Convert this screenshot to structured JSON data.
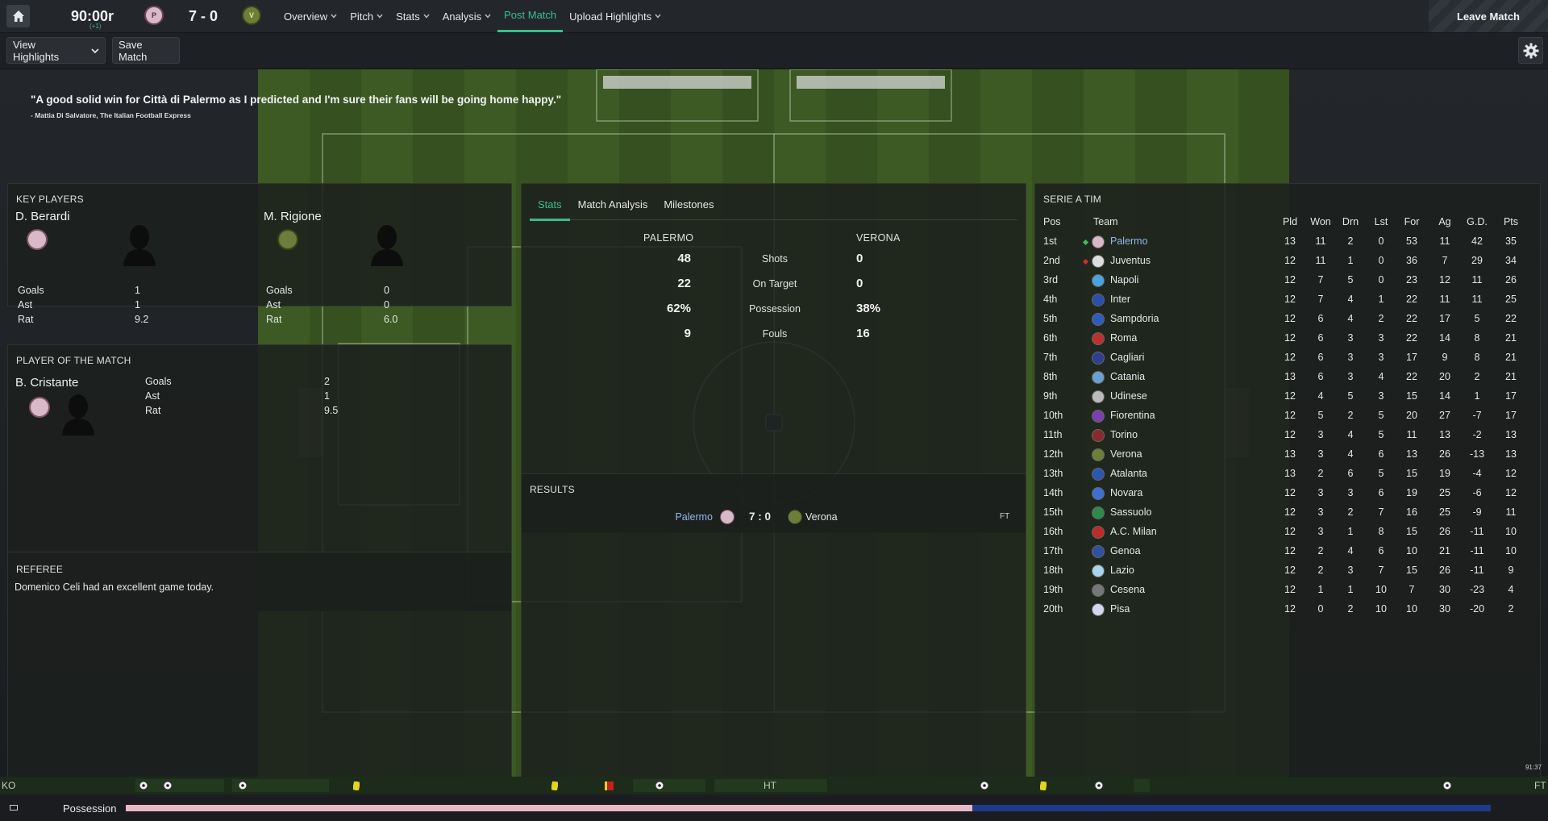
{
  "topbar": {
    "clock": "90:00r",
    "clock_sub": "(+1)",
    "score": "7 - 0",
    "nav": [
      {
        "label": "Overview",
        "dropdown": true,
        "active": false
      },
      {
        "label": "Pitch",
        "dropdown": true,
        "active": false
      },
      {
        "label": "Stats",
        "dropdown": true,
        "active": false
      },
      {
        "label": "Analysis",
        "dropdown": true,
        "active": false
      },
      {
        "label": "Post Match",
        "dropdown": false,
        "active": true
      },
      {
        "label": "Upload Highlights",
        "dropdown": true,
        "active": false
      }
    ],
    "leave_label": "Leave Match"
  },
  "subbar": {
    "view_highlights": "View Highlights",
    "save_match": "Save Match"
  },
  "quote": {
    "text": "\"A good solid win for Città di Palermo as I predicted and I'm sure their fans will be going home happy.\"",
    "source": "- Mattia Di Salvatore, The Italian Football Express"
  },
  "key_players": {
    "title": "KEY PLAYERS",
    "players": [
      {
        "name": "D. Berardi",
        "stats": [
          {
            "label": "Goals",
            "value": "1"
          },
          {
            "label": "Ast",
            "value": "1"
          },
          {
            "label": "Rat",
            "value": "9.2"
          }
        ]
      },
      {
        "name": "M. Rigione",
        "stats": [
          {
            "label": "Goals",
            "value": "0"
          },
          {
            "label": "Ast",
            "value": "0"
          },
          {
            "label": "Rat",
            "value": "6.0"
          }
        ]
      }
    ]
  },
  "potm": {
    "title": "PLAYER OF THE MATCH",
    "name": "B. Cristante",
    "stats": [
      {
        "label": "Goals",
        "value": "2"
      },
      {
        "label": "Ast",
        "value": "1"
      },
      {
        "label": "Rat",
        "value": "9.5"
      }
    ]
  },
  "referee": {
    "title": "REFEREE",
    "text": "Domenico Celi had an excellent game today."
  },
  "stats_panel": {
    "tabs": [
      "Stats",
      "Match Analysis",
      "Milestones"
    ],
    "home_team": "PALERMO",
    "away_team": "VERONA",
    "rows": [
      {
        "label": "Shots",
        "home": "48",
        "away": "0"
      },
      {
        "label": "On Target",
        "home": "22",
        "away": "0"
      },
      {
        "label": "Possession",
        "home": "62%",
        "away": "38%"
      },
      {
        "label": "Fouls",
        "home": "9",
        "away": "16"
      }
    ]
  },
  "results": {
    "title": "RESULTS",
    "home": "Palermo",
    "score": "7 : 0",
    "away": "Verona",
    "status": "FT"
  },
  "league": {
    "title": "SERIE A TIM",
    "headers": [
      "Pos",
      "Team",
      "Pld",
      "Won",
      "Drn",
      "Lst",
      "For",
      "Ag",
      "G.D.",
      "Pts"
    ],
    "rows": [
      {
        "pos": "1st",
        "team": "Palermo",
        "pld": "13",
        "won": "11",
        "drn": "2",
        "lst": "0",
        "for": "53",
        "ag": "11",
        "gd": "42",
        "pts": "35",
        "color": "#d9b8c8",
        "trend": "up",
        "highlight": true
      },
      {
        "pos": "2nd",
        "team": "Juventus",
        "pld": "12",
        "won": "11",
        "drn": "1",
        "lst": "0",
        "for": "36",
        "ag": "7",
        "gd": "29",
        "pts": "34",
        "color": "#dddddd",
        "trend": "down"
      },
      {
        "pos": "3rd",
        "team": "Napoli",
        "pld": "12",
        "won": "7",
        "drn": "5",
        "lst": "0",
        "for": "23",
        "ag": "12",
        "gd": "11",
        "pts": "26",
        "color": "#4aa3e0"
      },
      {
        "pos": "4th",
        "team": "Inter",
        "pld": "12",
        "won": "7",
        "drn": "4",
        "lst": "1",
        "for": "22",
        "ag": "11",
        "gd": "11",
        "pts": "25",
        "color": "#2a4fa8"
      },
      {
        "pos": "5th",
        "team": "Sampdoria",
        "pld": "12",
        "won": "6",
        "drn": "4",
        "lst": "2",
        "for": "22",
        "ag": "17",
        "gd": "5",
        "pts": "22",
        "color": "#2d5bc0"
      },
      {
        "pos": "6th",
        "team": "Roma",
        "pld": "12",
        "won": "6",
        "drn": "3",
        "lst": "3",
        "for": "22",
        "ag": "14",
        "gd": "8",
        "pts": "21",
        "color": "#b8322f"
      },
      {
        "pos": "7th",
        "team": "Cagliari",
        "pld": "12",
        "won": "6",
        "drn": "3",
        "lst": "3",
        "for": "17",
        "ag": "9",
        "gd": "8",
        "pts": "21",
        "color": "#2e3f8f"
      },
      {
        "pos": "8th",
        "team": "Catania",
        "pld": "13",
        "won": "6",
        "drn": "3",
        "lst": "4",
        "for": "22",
        "ag": "20",
        "gd": "2",
        "pts": "21",
        "color": "#6aa0d0"
      },
      {
        "pos": "9th",
        "team": "Udinese",
        "pld": "12",
        "won": "4",
        "drn": "5",
        "lst": "3",
        "for": "15",
        "ag": "14",
        "gd": "1",
        "pts": "17",
        "color": "#bbbbbb"
      },
      {
        "pos": "10th",
        "team": "Fiorentina",
        "pld": "12",
        "won": "5",
        "drn": "2",
        "lst": "5",
        "for": "20",
        "ag": "27",
        "gd": "-7",
        "pts": "17",
        "color": "#7a3fb0"
      },
      {
        "pos": "11th",
        "team": "Torino",
        "pld": "12",
        "won": "3",
        "drn": "4",
        "lst": "5",
        "for": "11",
        "ag": "13",
        "gd": "-2",
        "pts": "13",
        "color": "#8a2a2a"
      },
      {
        "pos": "12th",
        "team": "Verona",
        "pld": "13",
        "won": "3",
        "drn": "4",
        "lst": "6",
        "for": "13",
        "ag": "26",
        "gd": "-13",
        "pts": "13",
        "color": "#6d7d3a"
      },
      {
        "pos": "13th",
        "team": "Atalanta",
        "pld": "13",
        "won": "2",
        "drn": "6",
        "lst": "5",
        "for": "15",
        "ag": "19",
        "gd": "-4",
        "pts": "12",
        "color": "#2a57b0"
      },
      {
        "pos": "14th",
        "team": "Novara",
        "pld": "12",
        "won": "3",
        "drn": "3",
        "lst": "6",
        "for": "19",
        "ag": "25",
        "gd": "-6",
        "pts": "12",
        "color": "#3f6fd0"
      },
      {
        "pos": "15th",
        "team": "Sassuolo",
        "pld": "12",
        "won": "3",
        "drn": "2",
        "lst": "7",
        "for": "16",
        "ag": "25",
        "gd": "-9",
        "pts": "11",
        "color": "#2f8a4a"
      },
      {
        "pos": "16th",
        "team": "A.C. Milan",
        "pld": "12",
        "won": "3",
        "drn": "1",
        "lst": "8",
        "for": "15",
        "ag": "26",
        "gd": "-11",
        "pts": "10",
        "color": "#c02a2a"
      },
      {
        "pos": "17th",
        "team": "Genoa",
        "pld": "12",
        "won": "2",
        "drn": "4",
        "lst": "6",
        "for": "10",
        "ag": "21",
        "gd": "-11",
        "pts": "10",
        "color": "#3050a0"
      },
      {
        "pos": "18th",
        "team": "Lazio",
        "pld": "12",
        "won": "2",
        "drn": "3",
        "lst": "7",
        "for": "15",
        "ag": "26",
        "gd": "-11",
        "pts": "9",
        "color": "#a9d4ee"
      },
      {
        "pos": "19th",
        "team": "Cesena",
        "pld": "12",
        "won": "1",
        "drn": "1",
        "lst": "10",
        "for": "7",
        "ag": "30",
        "gd": "-23",
        "pts": "4",
        "color": "#777777"
      },
      {
        "pos": "20th",
        "team": "Pisa",
        "pld": "12",
        "won": "0",
        "drn": "2",
        "lst": "10",
        "for": "10",
        "ag": "30",
        "gd": "-20",
        "pts": "2",
        "color": "#cfd8ee"
      }
    ]
  },
  "timeline": {
    "start": "KO",
    "half": "HT",
    "end": "FT",
    "corner_time": "91:37"
  },
  "possession": {
    "label": "Possession",
    "home_pct": 62,
    "home_color": "#e8b7c8",
    "away_color": "#1f3c8c"
  },
  "colors": {
    "accent": "#3bbf8b",
    "highlight_team": "#8fb6e8"
  }
}
